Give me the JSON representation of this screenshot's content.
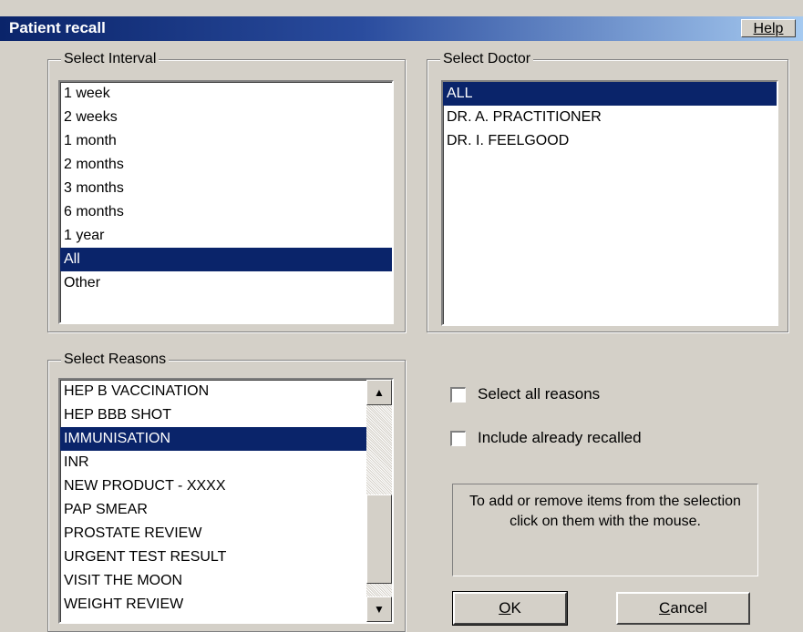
{
  "window": {
    "title": "Patient recall",
    "help_label": "Help"
  },
  "interval": {
    "group_label": "Select Interval",
    "items": [
      "1 week",
      "2 weeks",
      "1 month",
      "2 months",
      "3 months",
      "6 months",
      "1 year",
      "All",
      "Other"
    ],
    "selected": "All"
  },
  "doctor": {
    "group_label": "Select Doctor",
    "items": [
      "ALL",
      "DR. A. PRACTITIONER",
      "DR. I. FEELGOOD"
    ],
    "selected": "ALL"
  },
  "reasons": {
    "group_label": "Select Reasons",
    "items": [
      "HEP B VACCINATION",
      "HEP BBB SHOT",
      "IMMUNISATION",
      "INR",
      "NEW PRODUCT - XXXX",
      "PAP SMEAR",
      "PROSTATE REVIEW",
      "URGENT TEST RESULT",
      "VISIT THE MOON",
      "WEIGHT REVIEW"
    ],
    "selected": "IMMUNISATION"
  },
  "options": {
    "select_all_reasons": "Select all reasons",
    "select_all_reasons_checked": false,
    "include_already_recalled": "Include already recalled",
    "include_already_recalled_checked": false
  },
  "info": {
    "text": "To add or remove items from the selection click on them with the mouse."
  },
  "buttons": {
    "ok": "OK",
    "cancel": "Cancel"
  },
  "colors": {
    "selection": "#0a246a",
    "face": "#d4d0c8",
    "title_gradient_start": "#0a246a",
    "title_gradient_end": "#a6caf0"
  }
}
